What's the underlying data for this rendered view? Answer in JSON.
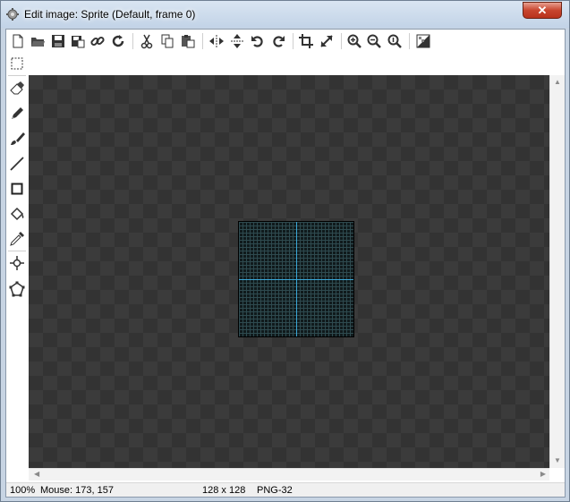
{
  "window": {
    "title": "Edit image: Sprite (Default, frame 0)",
    "close_label": "✕"
  },
  "toolbar": {
    "buttons": [
      {
        "name": "new-icon"
      },
      {
        "name": "open-icon"
      },
      {
        "name": "save-icon"
      },
      {
        "name": "save-as-icon"
      },
      {
        "name": "link-icon"
      },
      {
        "name": "reload-icon"
      },
      {
        "name": "cut-icon"
      },
      {
        "name": "copy-icon"
      },
      {
        "name": "paste-icon"
      },
      {
        "name": "flip-horizontal-icon"
      },
      {
        "name": "flip-vertical-icon"
      },
      {
        "name": "rotate-left-icon"
      },
      {
        "name": "rotate-right-icon"
      },
      {
        "name": "crop-icon"
      },
      {
        "name": "resize-icon"
      },
      {
        "name": "zoom-in-icon"
      },
      {
        "name": "zoom-out-icon"
      },
      {
        "name": "zoom-reset-icon"
      },
      {
        "name": "transparency-icon"
      }
    ]
  },
  "tools": [
    {
      "name": "select-rect-tool"
    },
    {
      "name": "eraser-tool"
    },
    {
      "name": "pencil-tool"
    },
    {
      "name": "brush-tool"
    },
    {
      "name": "line-tool"
    },
    {
      "name": "rectangle-tool"
    },
    {
      "name": "fill-tool"
    },
    {
      "name": "color-picker-tool"
    },
    {
      "name": "origin-tool"
    },
    {
      "name": "polygon-tool"
    }
  ],
  "colors": {
    "canvas_bg": "#3b3b3b",
    "sprite_grid": "#2e4a4f",
    "guide_line": "#3aa6d6"
  },
  "status": {
    "zoom": "100%",
    "mouse": "Mouse: 173, 157",
    "size": "128 x 128",
    "format": "PNG-32"
  }
}
